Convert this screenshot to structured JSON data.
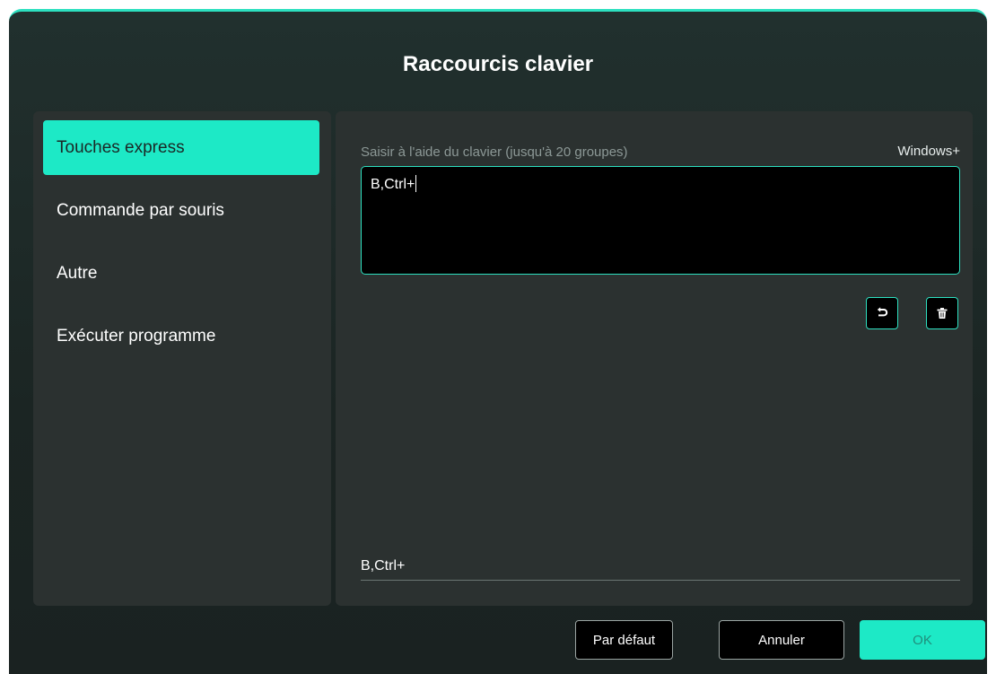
{
  "dialog": {
    "title": "Raccourcis clavier"
  },
  "sidebar": {
    "items": [
      {
        "label": "Touches express",
        "active": true
      },
      {
        "label": "Commande par souris",
        "active": false
      },
      {
        "label": "Autre",
        "active": false
      },
      {
        "label": "Exécuter programme",
        "active": false
      }
    ]
  },
  "main": {
    "hint": "Saisir à l'aide du clavier (jusqu'à 20 groupes)",
    "os_label": "Windows+",
    "input_value": "B,Ctrl+",
    "summary": "B,Ctrl+",
    "icons": {
      "undo": "undo-icon",
      "delete": "trash-icon"
    }
  },
  "footer": {
    "default_label": "Par défaut",
    "cancel_label": "Annuler",
    "ok_label": "OK"
  },
  "colors": {
    "accent": "#1de9c6",
    "panel": "#2b3130",
    "background": "#1b2523"
  }
}
